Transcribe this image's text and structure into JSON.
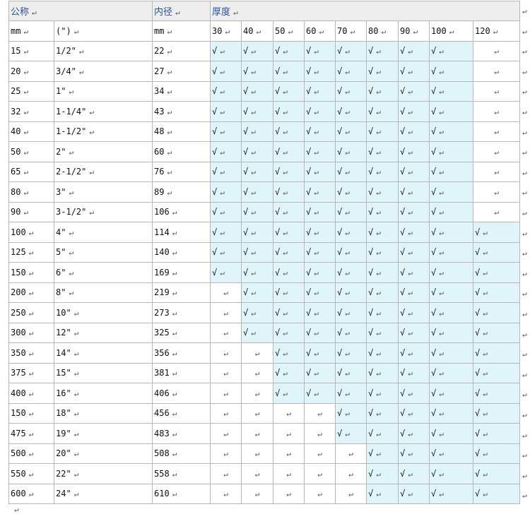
{
  "header": {
    "nominal_label": "公称",
    "inner_label": "内径",
    "thickness_label": "厚度",
    "mark": "↵"
  },
  "units_row": {
    "mm": "mm",
    "inch": "(\")",
    "inner_mm": "mm",
    "thicknesses": [
      "30",
      "40",
      "50",
      "60",
      "70",
      "80",
      "90",
      "100",
      "120"
    ]
  },
  "check_symbol": "√",
  "return_mark": "↵",
  "rows": [
    {
      "mm": "15",
      "inch": "1/2\"",
      "inner": "22",
      "checks": [
        1,
        1,
        1,
        1,
        1,
        1,
        1,
        1,
        0
      ]
    },
    {
      "mm": "20",
      "inch": "3/4\"",
      "inner": "27",
      "checks": [
        1,
        1,
        1,
        1,
        1,
        1,
        1,
        1,
        0
      ]
    },
    {
      "mm": "25",
      "inch": "1\"",
      "inner": "34",
      "checks": [
        1,
        1,
        1,
        1,
        1,
        1,
        1,
        1,
        0
      ]
    },
    {
      "mm": "32",
      "inch": "1-1/4\"",
      "inner": "43",
      "checks": [
        1,
        1,
        1,
        1,
        1,
        1,
        1,
        1,
        0
      ]
    },
    {
      "mm": "40",
      "inch": "1-1/2\"",
      "inner": "48",
      "checks": [
        1,
        1,
        1,
        1,
        1,
        1,
        1,
        1,
        0
      ]
    },
    {
      "mm": "50",
      "inch": "2\"",
      "inner": "60",
      "checks": [
        1,
        1,
        1,
        1,
        1,
        1,
        1,
        1,
        0
      ]
    },
    {
      "mm": "65",
      "inch": "2-1/2\"",
      "inner": "76",
      "checks": [
        1,
        1,
        1,
        1,
        1,
        1,
        1,
        1,
        0
      ]
    },
    {
      "mm": "80",
      "inch": "3\"",
      "inner": "89",
      "checks": [
        1,
        1,
        1,
        1,
        1,
        1,
        1,
        1,
        0
      ]
    },
    {
      "mm": "90",
      "inch": "3-1/2\"",
      "inner": "106",
      "checks": [
        1,
        1,
        1,
        1,
        1,
        1,
        1,
        1,
        0
      ]
    },
    {
      "mm": "100",
      "inch": "4\"",
      "inner": "114",
      "checks": [
        1,
        1,
        1,
        1,
        1,
        1,
        1,
        1,
        1
      ]
    },
    {
      "mm": "125",
      "inch": "5\"",
      "inner": "140",
      "checks": [
        1,
        1,
        1,
        1,
        1,
        1,
        1,
        1,
        1
      ]
    },
    {
      "mm": "150",
      "inch": "6\"",
      "inner": "169",
      "checks": [
        1,
        1,
        1,
        1,
        1,
        1,
        1,
        1,
        1
      ]
    },
    {
      "mm": "200",
      "inch": "8\"",
      "inner": "219",
      "checks": [
        0,
        1,
        1,
        1,
        1,
        1,
        1,
        1,
        1
      ]
    },
    {
      "mm": "250",
      "inch": "10\"",
      "inner": "273",
      "checks": [
        0,
        1,
        1,
        1,
        1,
        1,
        1,
        1,
        1
      ]
    },
    {
      "mm": "300",
      "inch": "12\"",
      "inner": "325",
      "checks": [
        0,
        1,
        1,
        1,
        1,
        1,
        1,
        1,
        1
      ]
    },
    {
      "mm": "350",
      "inch": "14\"",
      "inner": "356",
      "checks": [
        0,
        0,
        1,
        1,
        1,
        1,
        1,
        1,
        1
      ]
    },
    {
      "mm": "375",
      "inch": "15\"",
      "inner": "381",
      "checks": [
        0,
        0,
        1,
        1,
        1,
        1,
        1,
        1,
        1
      ]
    },
    {
      "mm": "400",
      "inch": "16\"",
      "inner": "406",
      "checks": [
        0,
        0,
        1,
        1,
        1,
        1,
        1,
        1,
        1
      ]
    },
    {
      "mm": "150",
      "inch": "18\"",
      "inner": "456",
      "checks": [
        0,
        0,
        0,
        0,
        1,
        1,
        1,
        1,
        1
      ]
    },
    {
      "mm": "475",
      "inch": "19\"",
      "inner": "483",
      "checks": [
        0,
        0,
        0,
        0,
        1,
        1,
        1,
        1,
        1
      ]
    },
    {
      "mm": "500",
      "inch": "20\"",
      "inner": "508",
      "checks": [
        0,
        0,
        0,
        0,
        0,
        1,
        1,
        1,
        1
      ]
    },
    {
      "mm": "550",
      "inch": "22\"",
      "inner": "558",
      "checks": [
        0,
        0,
        0,
        0,
        0,
        1,
        1,
        1,
        1
      ]
    },
    {
      "mm": "600",
      "inch": "24\"",
      "inner": "610",
      "checks": [
        0,
        0,
        0,
        0,
        0,
        1,
        1,
        1,
        1
      ]
    }
  ],
  "colors": {
    "header_bg": "#eeeeee",
    "header_text": "#2a4f9d",
    "check_fill": "#dff5fa",
    "border": "#b7b7b7"
  }
}
